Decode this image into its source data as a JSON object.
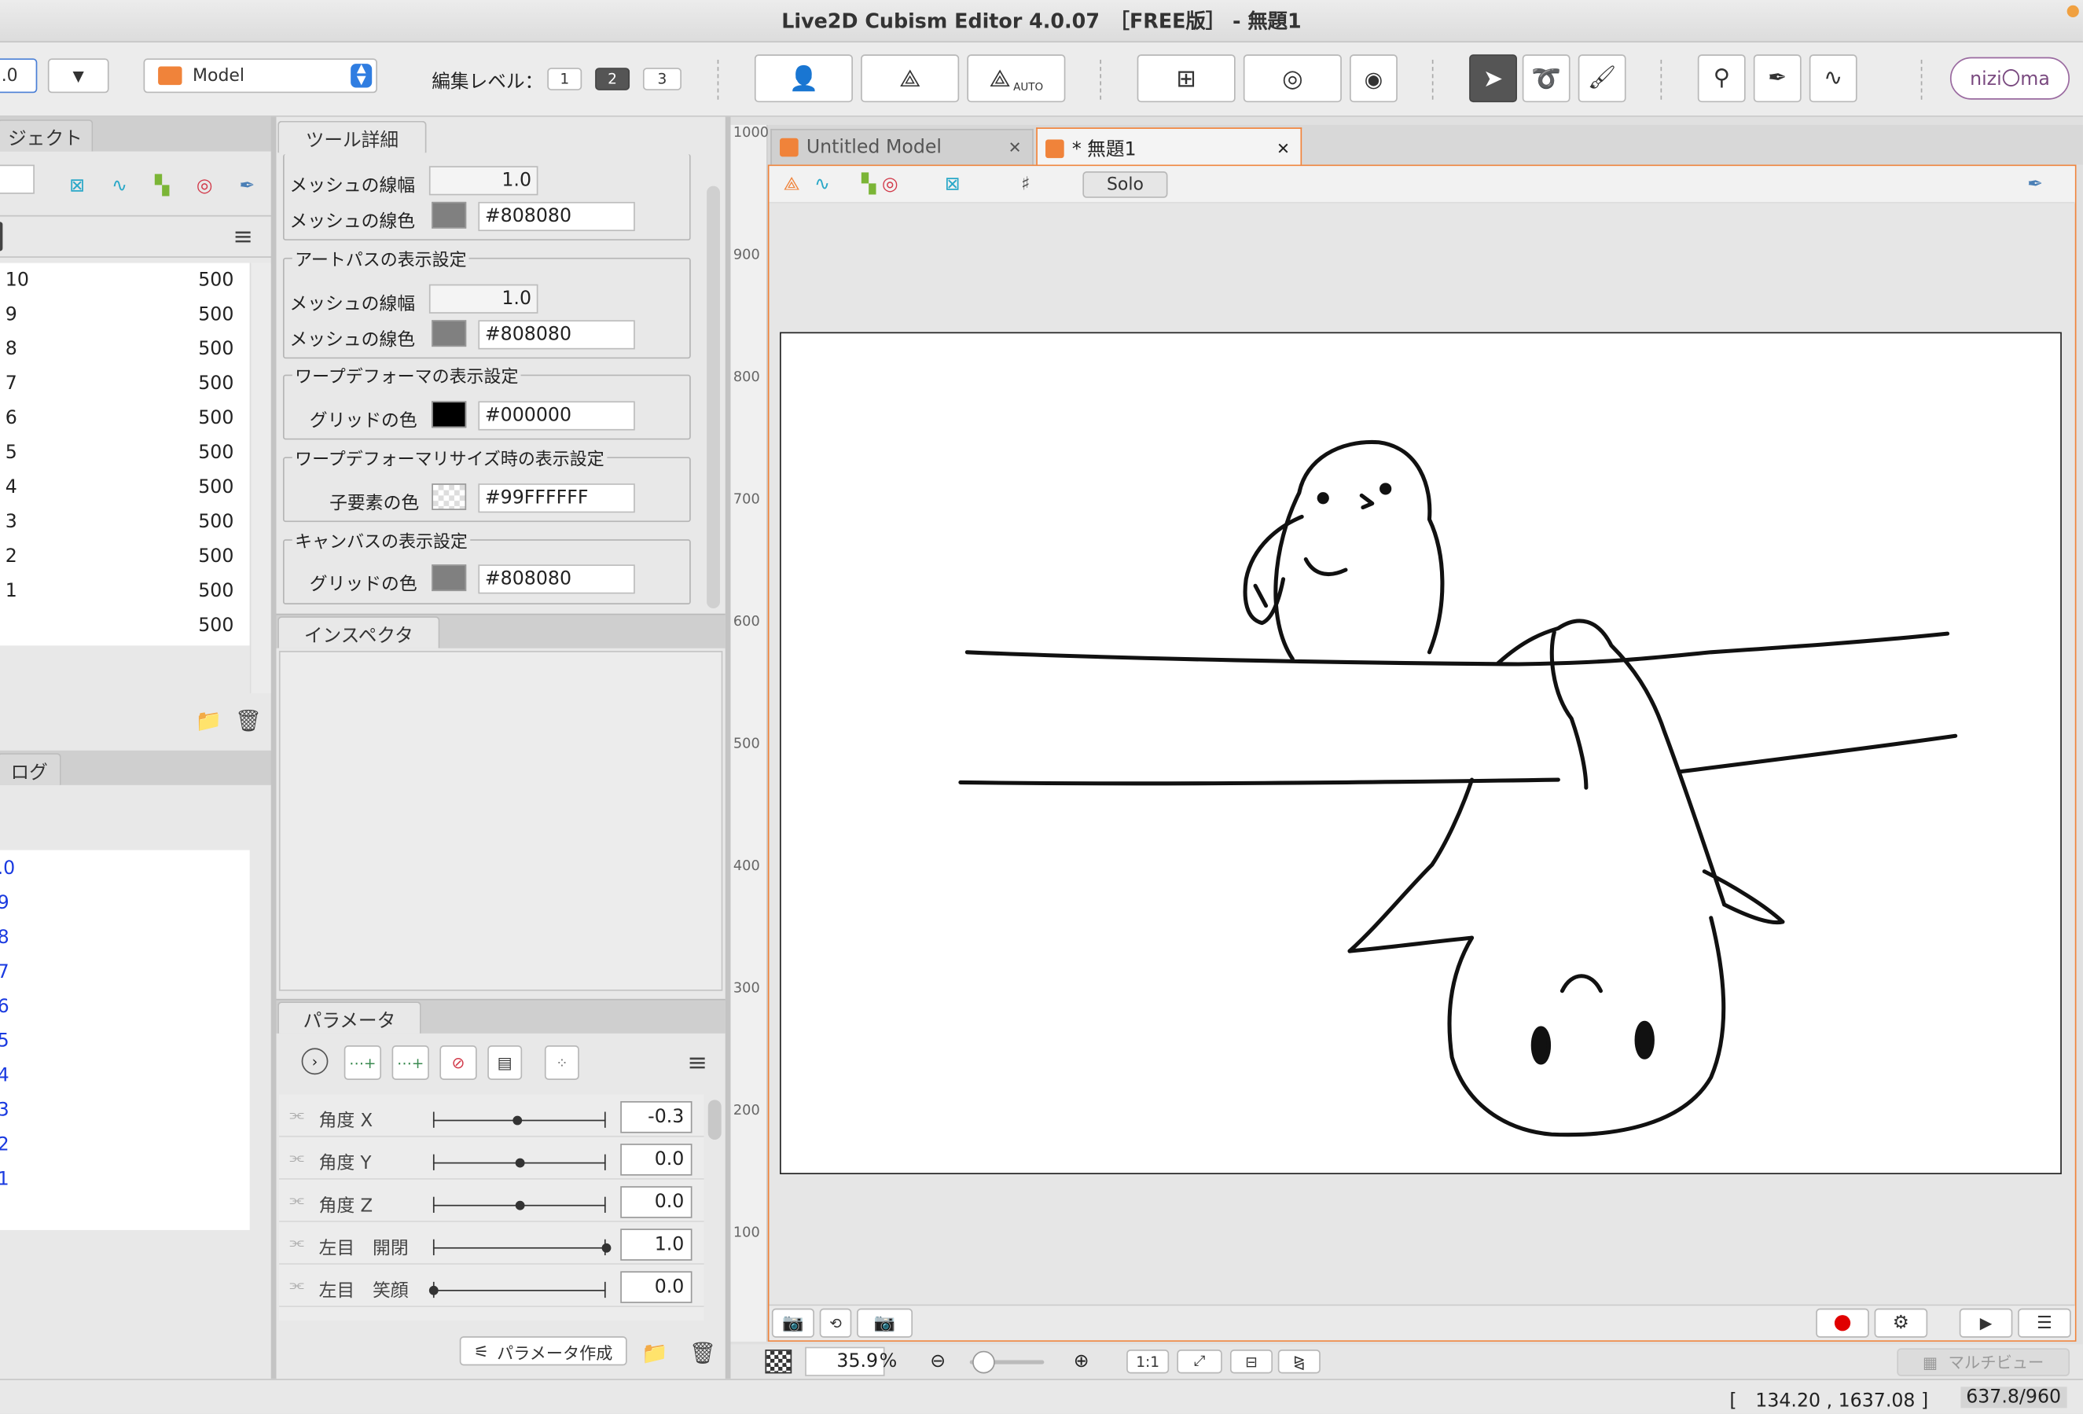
{
  "window": {
    "title": "Live2D Cubism Editor 4.0.07　［FREE版］ - 無題1"
  },
  "toolbar": {
    "partial_value": ".0",
    "model_select": "Model",
    "edit_level_label": "編集レベル：",
    "edit_levels": [
      "1",
      "2",
      "3"
    ],
    "active_level": "2",
    "auto_label": "AUTO",
    "nizima_label": "nizi〇ma"
  },
  "left_panel": {
    "tab_label": "ジェクト",
    "rows": [
      {
        "id": "10",
        "val": "500"
      },
      {
        "id": "9",
        "val": "500"
      },
      {
        "id": "8",
        "val": "500"
      },
      {
        "id": "7",
        "val": "500"
      },
      {
        "id": "6",
        "val": "500"
      },
      {
        "id": "5",
        "val": "500"
      },
      {
        "id": "4",
        "val": "500"
      },
      {
        "id": "3",
        "val": "500"
      },
      {
        "id": "2",
        "val": "500"
      },
      {
        "id": "1",
        "val": "500"
      },
      {
        "id": "",
        "val": "500"
      }
    ],
    "log_tab_label": "ログ",
    "log_lines": [
      ".0",
      "9",
      "8",
      "7",
      "6",
      "5",
      "4",
      "3",
      "2",
      "1"
    ]
  },
  "tool_detail": {
    "tab_label": "ツール詳細",
    "mesh_line_width_label": "メッシュの線幅",
    "mesh_line_width": "1.0",
    "mesh_line_color_label": "メッシュの線色",
    "mesh_line_color": "#808080",
    "artpath_title": "アートパスの表示設定",
    "artpath_width_label": "メッシュの線幅",
    "artpath_width": "1.0",
    "artpath_color_label": "メッシュの線色",
    "artpath_color": "#808080",
    "warp_title": "ワープデフォーマの表示設定",
    "warp_grid_label": "グリッドの色",
    "warp_grid_color": "#000000",
    "warp_resize_title": "ワープデフォーマリサイズ時の表示設定",
    "child_color_label": "子要素の色",
    "child_color": "#99FFFFFF",
    "canvas_title": "キャンバスの表示設定",
    "canvas_grid_label": "グリッドの色",
    "canvas_grid_color": "#808080"
  },
  "inspector": {
    "tab_label": "インスペクタ"
  },
  "parameters": {
    "tab_label": "パラメータ",
    "create_label": "パラメータ作成",
    "items": [
      {
        "name": "角度 X",
        "value": "-0.3",
        "pos": 0.49
      },
      {
        "name": "角度 Y",
        "value": "0.0",
        "pos": 0.5
      },
      {
        "name": "角度 Z",
        "value": "0.0",
        "pos": 0.5
      },
      {
        "name": "左目　開閉",
        "value": "1.0",
        "pos": 1.0
      },
      {
        "name": "左目　笑顔",
        "value": "0.0",
        "pos": 0.0
      }
    ]
  },
  "viewport": {
    "tabs": [
      {
        "label": "Untitled Model",
        "active": false
      },
      {
        "label": "* 無題1",
        "active": true
      }
    ],
    "solo_label": "Solo",
    "ruler_labels": [
      "1000",
      "900",
      "800",
      "700",
      "600",
      "500",
      "400",
      "300",
      "200",
      "100"
    ],
    "zoom": "35.9",
    "zoom_unit": "%",
    "one_to_one": "1:1",
    "multiview_label": "マルチビュー"
  },
  "status": {
    "coords": "[　134.20 , 1637.08 ]",
    "ratio": "637.8/960"
  },
  "colors": {
    "accent": "#f0833a",
    "record": "#e00000",
    "icon_teal": "#2aa8c8",
    "icon_green": "#7bb536",
    "icon_red": "#d23a4a",
    "log_blue": "#1a3ae0"
  }
}
